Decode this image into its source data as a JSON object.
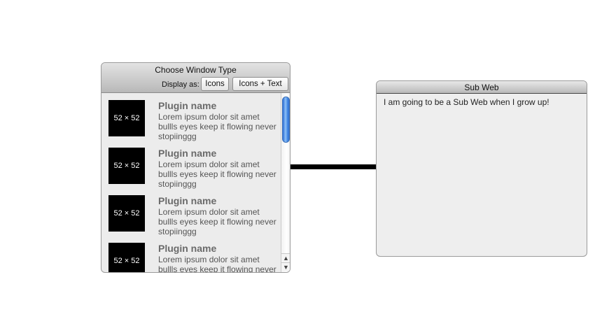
{
  "chooser": {
    "title": "Choose Window Type",
    "display_label": "Display as:",
    "buttons": {
      "icons": "Icons",
      "icons_text": "Icons + Text"
    },
    "items": [
      {
        "thumb": "52 × 52",
        "name": "Plugin name",
        "desc": "Lorem ipsum dolor sit amet bullls eyes keep it flowing never stopiinggg"
      },
      {
        "thumb": "52 × 52",
        "name": "Plugin name",
        "desc": "Lorem ipsum dolor sit amet bullls eyes keep it flowing never stopiinggg"
      },
      {
        "thumb": "52 × 52",
        "name": "Plugin name",
        "desc": "Lorem ipsum dolor sit amet bullls eyes keep it flowing never stopiinggg"
      },
      {
        "thumb": "52 × 52",
        "name": "Plugin name",
        "desc": "Lorem ipsum dolor sit amet bullls eyes keep it flowing never stopiinggg"
      }
    ],
    "scroll": {
      "up_icon": "▲",
      "down_icon": "▼"
    }
  },
  "subweb": {
    "title": "Sub Web",
    "body": "I am going to be a Sub Web when I grow up!"
  },
  "colors": {
    "connector": "#000000",
    "scroll_thumb": "#4a8de6"
  }
}
